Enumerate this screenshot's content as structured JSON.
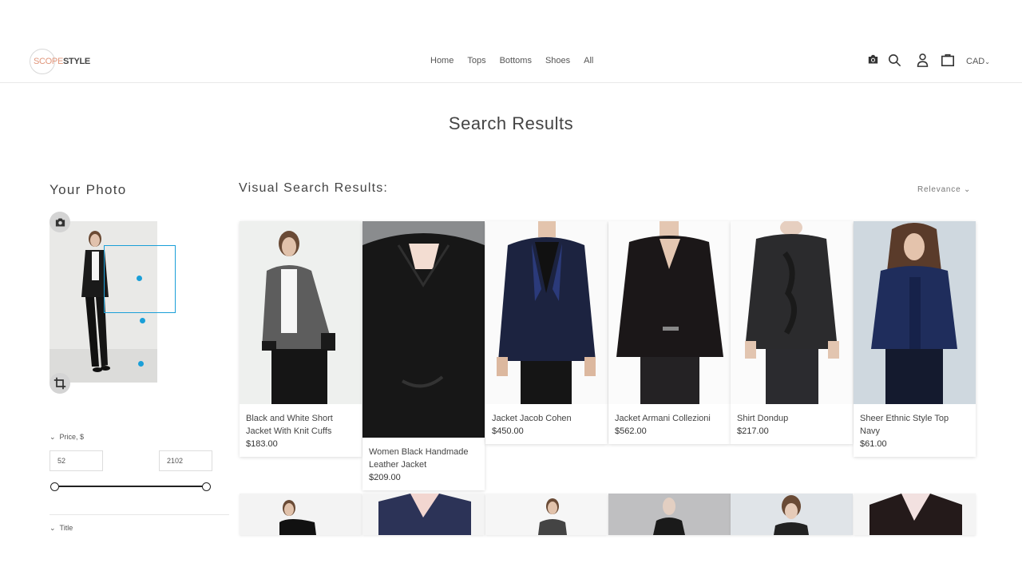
{
  "header": {
    "logo_part1": "SCOPE",
    "logo_part2": "STYLE",
    "nav": [
      "Home",
      "Tops",
      "Bottoms",
      "Shoes",
      "All"
    ],
    "currency": "CAD",
    "icons": [
      "camera-icon",
      "search-icon",
      "user-icon",
      "bag-icon",
      "chevron-down-icon"
    ]
  },
  "page_title": "Search Results",
  "sidebar": {
    "title": "Your Photo",
    "price_filter_label": "Price, $",
    "price_min": "52",
    "price_max": "2102",
    "slider_min_fraction": 0,
    "slider_max_fraction": 1,
    "title_filter_label": "Title"
  },
  "results": {
    "heading": "Visual Search Results:",
    "sort_label": "Relevance",
    "products": [
      {
        "name": "Black and White Short Jacket With Knit Cuffs",
        "price": "$183.00"
      },
      {
        "name": "Women Black Handmade Leather Jacket",
        "price": "$209.00"
      },
      {
        "name": "Jacket Jacob Cohen",
        "price": "$450.00"
      },
      {
        "name": "Jacket Armani Collezioni",
        "price": "$562.00"
      },
      {
        "name": "Shirt Dondup",
        "price": "$217.00"
      },
      {
        "name": "Sheer Ethnic Style Top Navy",
        "price": "$61.00"
      }
    ]
  },
  "colors": {
    "accent": "#1a9fd8",
    "logo_accent": "#e0957a"
  }
}
